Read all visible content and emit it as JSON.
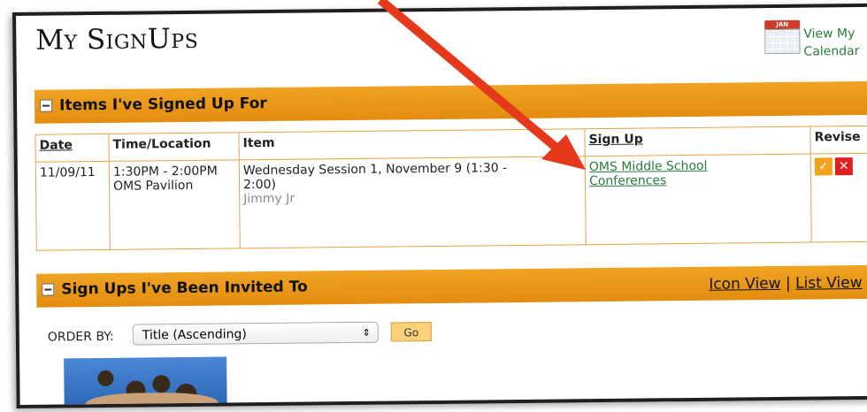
{
  "page_title": "My SignUps",
  "calendar_link": {
    "icon_text": "JAN",
    "line1": "View My",
    "line2": "Calendar"
  },
  "signed_up_section": {
    "title": "Items I've Signed Up For",
    "columns": [
      "Date",
      "Time/Location",
      "Item",
      "Sign Up",
      "Revise"
    ],
    "rows": [
      {
        "date": "11/09/11",
        "time": "1:30PM - 2:00PM",
        "location": "OMS Pavilion",
        "item_line1": "Wednesday Session 1, November 9 (1:30 -",
        "item_line2": "2:00)",
        "person": "Jimmy Jr",
        "signup_line1": "OMS Middle School",
        "signup_line2": "Conferences"
      }
    ]
  },
  "invited_section": {
    "title": "Sign Ups I've Been Invited To",
    "icon_view": "Icon View",
    "separator": "|",
    "list_view": "List View"
  },
  "order_by": {
    "label": "ORDER BY:",
    "selected": "Title (Ascending)",
    "go": "Go"
  },
  "colors": {
    "accent": "#e38d10",
    "link": "#2a7a3a",
    "arrow": "#e5391c"
  }
}
